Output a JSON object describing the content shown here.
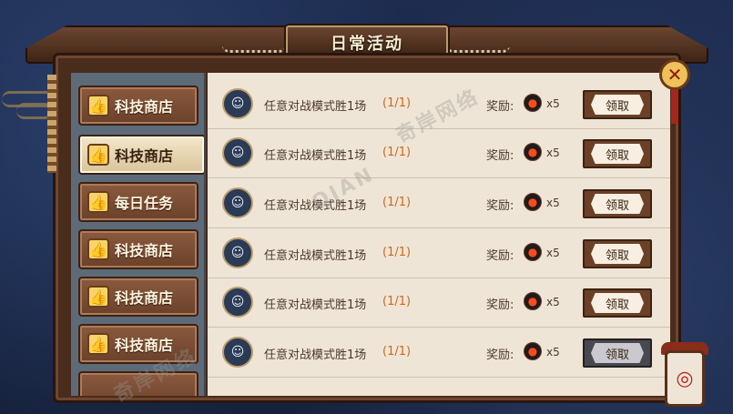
{
  "title": "日常活动",
  "sidebar": {
    "items": [
      {
        "label": "科技商店",
        "active": false
      },
      {
        "label": "科技商店",
        "active": true
      },
      {
        "label": "每日任务",
        "active": false
      },
      {
        "label": "科技商店",
        "active": false
      },
      {
        "label": "科技商店",
        "active": false
      },
      {
        "label": "科技商店",
        "active": false
      }
    ]
  },
  "tasks": [
    {
      "name": "任意对战模式胜1场",
      "progress": "(1/1)",
      "reward_label": "奖励:",
      "count": "x5",
      "claim_label": "领取",
      "disabled": false
    },
    {
      "name": "任意对战模式胜1场",
      "progress": "(1/1)",
      "reward_label": "奖励:",
      "count": "x5",
      "claim_label": "领取",
      "disabled": false
    },
    {
      "name": "任意对战模式胜1场",
      "progress": "(1/1)",
      "reward_label": "奖励:",
      "count": "x5",
      "claim_label": "领取",
      "disabled": false
    },
    {
      "name": "任意对战模式胜1场",
      "progress": "(1/1)",
      "reward_label": "奖励:",
      "count": "x5",
      "claim_label": "领取",
      "disabled": false
    },
    {
      "name": "任意对战模式胜1场",
      "progress": "(1/1)",
      "reward_label": "奖励:",
      "count": "x5",
      "claim_label": "领取",
      "disabled": false
    },
    {
      "name": "任意对战模式胜1场",
      "progress": "(1/1)",
      "reward_label": "奖励:",
      "count": "x5",
      "claim_label": "领取",
      "disabled": true
    }
  ],
  "watermark": "奇岸网络",
  "watermark_latin": "QIAN",
  "colors": {
    "progress": "#c96a1f",
    "claim_active": "#6b4027",
    "claim_disabled": "#48484e"
  },
  "icons": {
    "close": "close-icon",
    "thumb": "thumbs-up-icon",
    "reward": "fire-icon",
    "avatar": "character-avatar-icon"
  }
}
